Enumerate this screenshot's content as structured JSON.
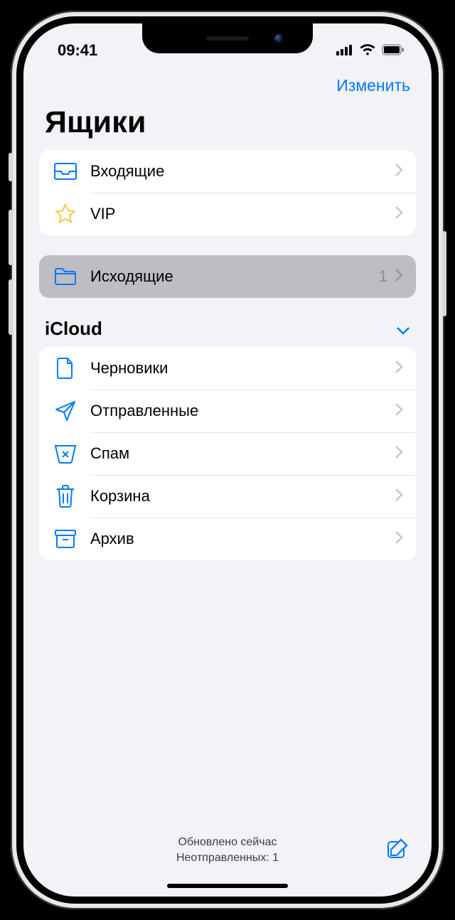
{
  "status": {
    "time": "09:41"
  },
  "nav": {
    "edit": "Изменить"
  },
  "title": "Ящики",
  "favorites": {
    "inbox": "Входящие",
    "vip": "VIP"
  },
  "outbox": {
    "label": "Исходящие",
    "count": "1"
  },
  "section": {
    "name": "iCloud"
  },
  "folders": {
    "drafts": "Черновики",
    "sent": "Отправленные",
    "junk": "Спам",
    "trash": "Корзина",
    "archive": "Архив"
  },
  "toolbar": {
    "line1": "Обновлено сейчас",
    "line2": "Неотправленных: 1"
  }
}
